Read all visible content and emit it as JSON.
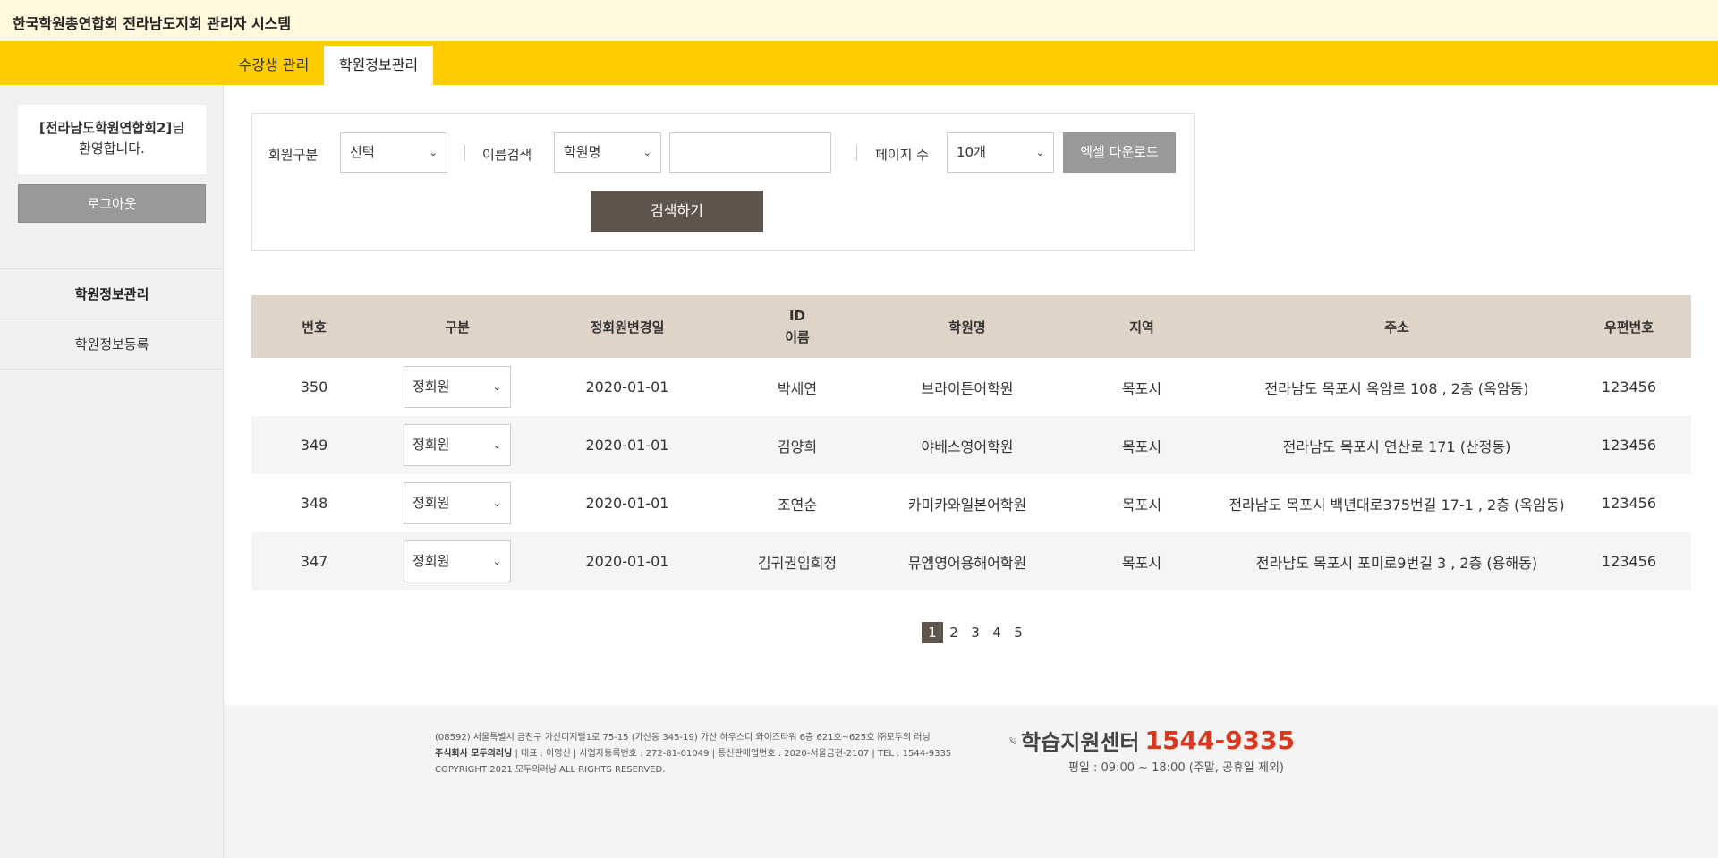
{
  "header": {
    "title": "한국학원총연합회 전라남도지회 관리자 시스템"
  },
  "nav": {
    "tabs": [
      {
        "label": "수강생 관리"
      },
      {
        "label": "학원정보관리"
      }
    ]
  },
  "sidebar": {
    "welcome_name": "[전라남도학원연합회2]",
    "welcome_suffix": "님",
    "welcome_line2": "환영합니다.",
    "logout_label": "로그아웃",
    "menu": [
      {
        "label": "학원정보관리"
      },
      {
        "label": "학원정보등록"
      }
    ]
  },
  "search": {
    "member_type_label": "회원구분",
    "member_type_value": "선택",
    "name_search_label": "이름검색",
    "name_search_value": "학원명",
    "keyword_value": "",
    "page_size_label": "페이지 수",
    "page_size_value": "10개",
    "excel_label": "엑셀 다운로드",
    "search_label": "검색하기"
  },
  "table": {
    "headers": {
      "no": "번호",
      "type": "구분",
      "date": "정회원변경일",
      "id": "ID",
      "name": "이름",
      "academy": "학원명",
      "region": "지역",
      "address": "주소",
      "zip": "우편번호"
    },
    "rows": [
      {
        "no": "350",
        "type": "정회원",
        "date": "2020-01-01",
        "person": "박세연",
        "academy": "브라이튼어학원",
        "region": "목포시",
        "address": "전라남도 목포시 옥암로 108 , 2층 (옥암동)",
        "zip": "123456"
      },
      {
        "no": "349",
        "type": "정회원",
        "date": "2020-01-01",
        "person": "김양희",
        "academy": "야베스영어학원",
        "region": "목포시",
        "address": "전라남도 목포시 연산로 171 (산정동)",
        "zip": "123456"
      },
      {
        "no": "348",
        "type": "정회원",
        "date": "2020-01-01",
        "person": "조연순",
        "academy": "카미카와일본어학원",
        "region": "목포시",
        "address": "전라남도 목포시 백년대로375번길 17-1 , 2층 (옥암동)",
        "zip": "123456"
      },
      {
        "no": "347",
        "type": "정회원",
        "date": "2020-01-01",
        "person": "김귀권임희정",
        "academy": "뮤엠영어용해어학원",
        "region": "목포시",
        "address": "전라남도 목포시 포미로9번길 3 , 2층 (용해동)",
        "zip": "123456"
      }
    ]
  },
  "pagination": {
    "pages": [
      "1",
      "2",
      "3",
      "4",
      "5"
    ],
    "current": "1"
  },
  "footer": {
    "line1": "(08592) 서울특별시 금천구 가산디지털1로 75-15 (가산동 345-19) 가산 하우스디 와이즈타워 6층 621호~625호 ㈜모두의 러닝",
    "company": "주식회사 모두의러닝",
    "line2": "  |  대표 : 이영신  |  사업자등록번호 : 272-81-01049  |  통신판매업번호 : 2020-서울금천-2107  |  TEL : 1544-9335",
    "line3": "COPYRIGHT 2021 모두의러닝 ALL RIGHTS RESERVED.",
    "center_name": "학습지원센터",
    "center_phone": "1544-9335",
    "center_hours": "평일 : 09:00 ~ 18:00 (주말, 공휴일 제외)"
  },
  "colors": {
    "accent": "#ffcc00",
    "topbar": "#fff8dc",
    "button_dark": "#5e544b",
    "header_row": "#e0d3c7",
    "phone": "#d9381e"
  }
}
